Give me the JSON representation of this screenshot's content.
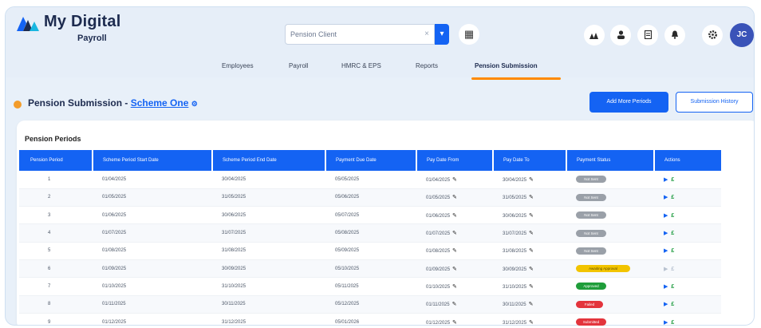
{
  "app": {
    "title": "My Digital",
    "subtitle": "Payroll"
  },
  "search": {
    "value": "Pension Client",
    "clear": "×"
  },
  "header_icons": [
    "users-icon",
    "user-icon",
    "document-icon",
    "bell-icon",
    "gear-icon"
  ],
  "avatar": "JC",
  "nav": {
    "tabs": [
      "Employees",
      "Payroll",
      "HMRC & EPS",
      "Reports",
      "Pension Submission"
    ],
    "active": 4
  },
  "page": {
    "title": "Pension Submission - ",
    "scheme": "Scheme One"
  },
  "buttons": {
    "add_periods": "Add More Periods",
    "history": "Submission History"
  },
  "table": {
    "section_title": "Pension Periods",
    "columns": [
      "Pension Period",
      "Scheme Period Start Date",
      "Scheme Period End Date",
      "Payment Due Date",
      "Pay Date From",
      "Pay Date To",
      "Payment Status",
      "Actions"
    ],
    "rows": [
      {
        "period": "1",
        "start": "01/04/2025",
        "end": "30/04/2025",
        "due": "05/05/2025",
        "from": "01/04/2025",
        "to": "30/04/2025",
        "status": "Not Sent",
        "status_color": "#9aa0a8"
      },
      {
        "period": "2",
        "start": "01/05/2025",
        "end": "31/05/2025",
        "due": "05/06/2025",
        "from": "01/05/2025",
        "to": "31/05/2025",
        "status": "Not Sent",
        "status_color": "#9aa0a8"
      },
      {
        "period": "3",
        "start": "01/06/2025",
        "end": "30/06/2025",
        "due": "05/07/2025",
        "from": "01/06/2025",
        "to": "30/06/2025",
        "status": "Not Sent",
        "status_color": "#9aa0a8"
      },
      {
        "period": "4",
        "start": "01/07/2025",
        "end": "31/07/2025",
        "due": "05/08/2025",
        "from": "01/07/2025",
        "to": "31/07/2025",
        "status": "Not Sent",
        "status_color": "#9aa0a8"
      },
      {
        "period": "5",
        "start": "01/08/2025",
        "end": "31/08/2025",
        "due": "05/09/2025",
        "from": "01/08/2025",
        "to": "31/08/2025",
        "status": "Not Sent",
        "status_color": "#9aa0a8"
      },
      {
        "period": "6",
        "start": "01/09/2025",
        "end": "30/09/2025",
        "due": "05/10/2025",
        "from": "01/09/2025",
        "to": "30/09/2025",
        "status": "Awaiting Approval",
        "status_color": "#f2c400"
      },
      {
        "period": "7",
        "start": "01/10/2025",
        "end": "31/10/2025",
        "due": "05/11/2025",
        "from": "01/10/2025",
        "to": "31/10/2025",
        "status": "Approved",
        "status_color": "#1f9d3a"
      },
      {
        "period": "8",
        "start": "01/11/2025",
        "end": "30/11/2025",
        "due": "05/12/2025",
        "from": "01/11/2025",
        "to": "30/11/2025",
        "status": "Failed",
        "status_color": "#e3343c"
      },
      {
        "period": "9",
        "start": "01/12/2025",
        "end": "31/12/2025",
        "due": "05/01/2026",
        "from": "01/12/2025",
        "to": "31/12/2025",
        "status": "Submitted",
        "status_color": "#e3343c"
      }
    ]
  },
  "colors": {
    "primary": "#1463f3",
    "accent": "#ff8a00",
    "pound": "#1a9a3c"
  }
}
